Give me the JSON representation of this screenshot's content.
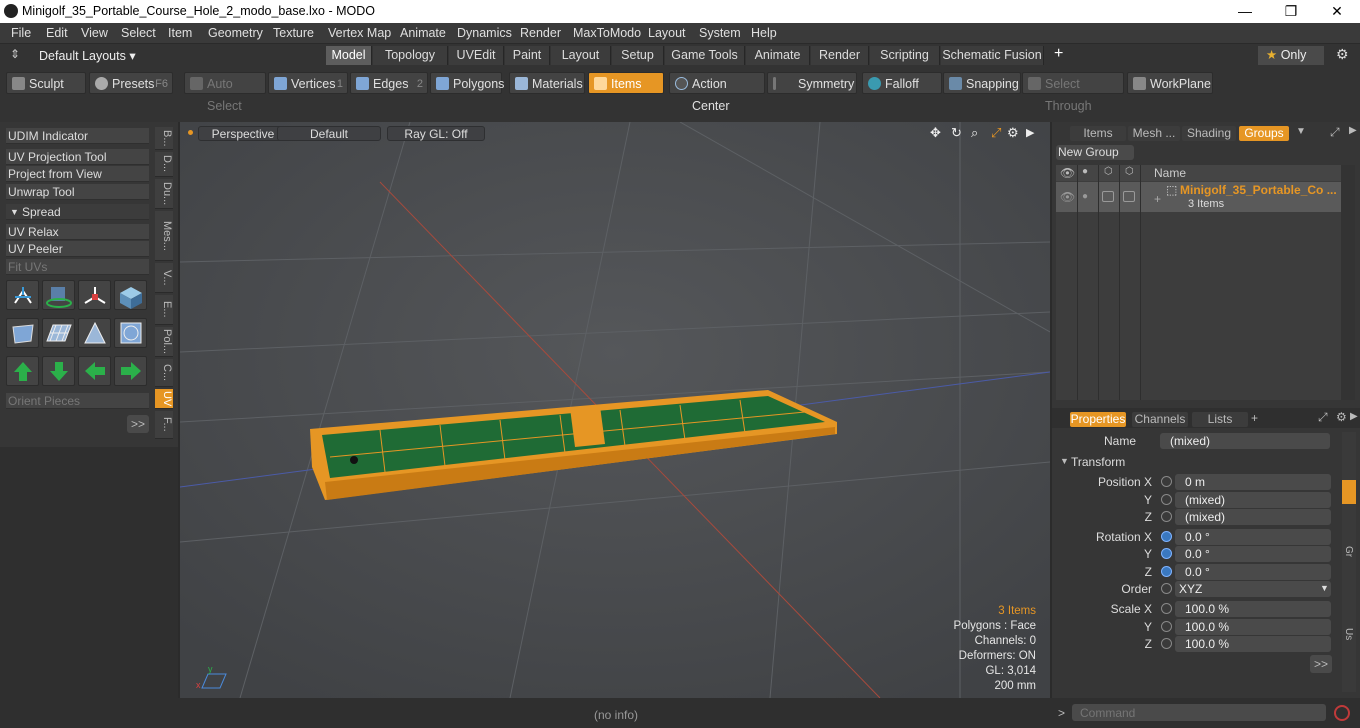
{
  "window": {
    "title": "Minigolf_35_Portable_Course_Hole_2_modo_base.lxo - MODO",
    "min": "—",
    "max": "❐",
    "close": "✕"
  },
  "menu": [
    "File",
    "Edit",
    "View",
    "Select",
    "Item",
    "Geometry",
    "Texture",
    "Vertex Map",
    "Animate",
    "Dynamics",
    "Render",
    "MaxToModo",
    "Layout",
    "System",
    "Help"
  ],
  "layouts": {
    "label": "Default Layouts ▾",
    "tabs": [
      "Model",
      "Topology",
      "UVEdit",
      "Paint",
      "Layout",
      "Setup",
      "Game Tools",
      "Animate",
      "Render",
      "Scripting",
      "Schematic Fusion"
    ],
    "add": "+",
    "only": "Only"
  },
  "toolbar": {
    "sculpt": "Sculpt",
    "presets": "Presets",
    "presets_key": "F6",
    "auto_select": "Auto Select",
    "vertices": "Vertices",
    "vertices_n": "1",
    "edges": "Edges",
    "edges_n": "2",
    "polygons": "Polygons",
    "materials": "Materials",
    "items": "Items",
    "action_center": "Action Center",
    "symmetry": "Symmetry",
    "falloff": "Falloff",
    "snapping": "Snapping",
    "select_through": "Select Through",
    "workplane": "WorkPlane"
  },
  "left": {
    "buttons": [
      "UDIM Indicator",
      "UV Projection Tool",
      "Project from View",
      "Unwrap Tool"
    ],
    "spread": "Spread",
    "buttons2": [
      "UV Relax",
      "UV Peeler",
      "Fit UVs"
    ],
    "orient": "Orient Pieces",
    "more": ">>",
    "vtabs": [
      "B...",
      "D...",
      "Du...",
      "Mes...",
      "V...",
      "E...",
      "Pol...",
      "C...",
      "UV",
      "F..."
    ]
  },
  "viewport": {
    "perspective": "Perspective",
    "default": "Default",
    "raygl": "Ray GL: Off",
    "info": {
      "items": "3 Items",
      "polygons": "Polygons : Face",
      "channels": "Channels: 0",
      "deformers": "Deformers: ON",
      "gl": "GL: 3,014",
      "scale": "200 mm"
    }
  },
  "groups": {
    "tabs": [
      "Items",
      "Mesh ...",
      "Shading",
      "Groups"
    ],
    "new_group": "New Group",
    "name_col": "Name",
    "group_name": "Minigolf_35_Portable_Co ...",
    "group_count": "3 Items"
  },
  "properties": {
    "tabs": [
      "Properties",
      "Channels",
      "Lists"
    ],
    "name_label": "Name",
    "name_value": "(mixed)",
    "section": "Transform",
    "rows": [
      {
        "label": "Position X",
        "value": "0 m"
      },
      {
        "label": "Y",
        "value": "(mixed)"
      },
      {
        "label": "Z",
        "value": "(mixed)"
      },
      {
        "label": "Rotation X",
        "value": "0.0 °"
      },
      {
        "label": "Y",
        "value": "0.0 °"
      },
      {
        "label": "Z",
        "value": "0.0 °"
      },
      {
        "label": "Order",
        "value": "XYZ"
      },
      {
        "label": "Scale X",
        "value": "100.0 %"
      },
      {
        "label": "Y",
        "value": "100.0 %"
      },
      {
        "label": "Z",
        "value": "100.0 %"
      }
    ],
    "more": ">>",
    "side_tabs": [
      "Gr",
      "Us"
    ]
  },
  "status": {
    "info": "(no info)",
    "command_placeholder": "Command",
    "prompt": ">"
  },
  "colors": {
    "accent": "#e69624",
    "green": "#1f7a3a",
    "viewport": "#494b4e"
  }
}
